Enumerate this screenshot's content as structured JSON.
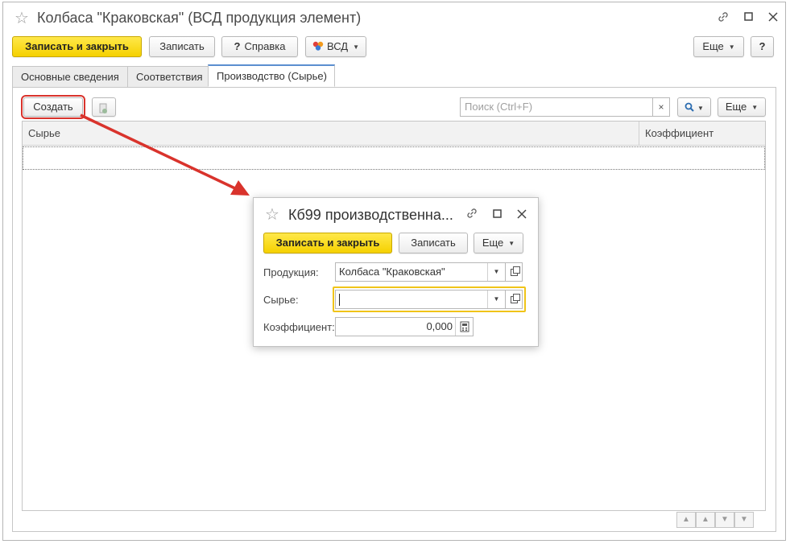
{
  "window": {
    "title": "Колбаса \"Краковская\" (ВСД продукция элемент)",
    "toolbar": {
      "save_close_label": "Записать и закрыть",
      "save_label": "Записать",
      "help_label": "Справка",
      "vsd_label": "ВСД",
      "more_label": "Еще",
      "help_question": "?"
    },
    "tabs": [
      {
        "label": "Основные сведения"
      },
      {
        "label": "Соответствия"
      },
      {
        "label": "Производство (Сырье)"
      }
    ],
    "panel": {
      "create_label": "Создать",
      "search_placeholder": "Поиск (Ctrl+F)",
      "search_clear": "×",
      "more_label": "Еще",
      "columns": [
        "Сырье",
        "Коэффициент"
      ]
    }
  },
  "dialog": {
    "title": "Кб99 производственна...",
    "save_close_label": "Записать и закрыть",
    "save_label": "Записать",
    "more_label": "Еще",
    "fields": {
      "product_label": "Продукция:",
      "product_value": "Колбаса \"Краковская\"",
      "raw_label": "Сырье:",
      "raw_value": "",
      "coef_label": "Коэффициент:",
      "coef_value": "0,000"
    }
  },
  "colors": {
    "primary_button": "#f5d100",
    "highlight_red": "#d9332c",
    "focus_yellow": "#f0c419",
    "active_tab": "#5b8ed0"
  }
}
